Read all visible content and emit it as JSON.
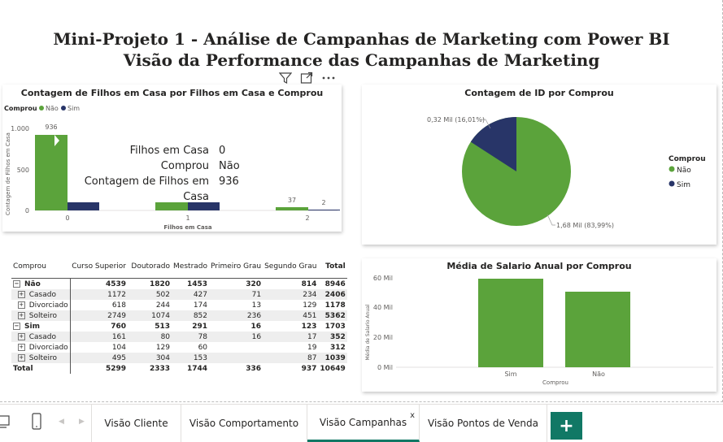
{
  "report": {
    "title_line1": "Mini-Projeto 1 - Análise de Campanhas de Marketing com Power BI",
    "title_line2": "Visão da Performance das Campanhas de Marketing"
  },
  "header_icons": [
    "filter-icon",
    "focus-mode-icon",
    "more-options-icon"
  ],
  "bar_visual": {
    "title": "Contagem de Filhos em Casa por Filhos em Casa e Comprou",
    "legend_title": "Comprou",
    "legend_nao": "Não",
    "legend_sim": "Sim",
    "y_axis_label": "Contagem de Filhos em Casa",
    "x_axis_label": "Filhos em Casa",
    "y_ticks": [
      "1.000",
      "500",
      "0"
    ],
    "label_936": "936",
    "label_37": "37",
    "label_2": "2",
    "x_ticks": [
      "0",
      "1",
      "2"
    ],
    "tooltip": {
      "k1": "Filhos em Casa",
      "v1": "0",
      "k2": "Comprou",
      "v2": "Não",
      "k3": "Contagem de Filhos em Casa",
      "v3": "936"
    }
  },
  "pie_visual": {
    "title": "Contagem de ID por Comprou",
    "label_sim": "0,32 Mil (16,01%)",
    "label_nao": "1,68 Mil (83,99%)",
    "legend_title": "Comprou",
    "legend_nao": "Não",
    "legend_sim": "Sim"
  },
  "salary_visual": {
    "title": "Média de Salario Anual por Comprou",
    "y_axis_label": "Média de Salario Anual",
    "x_axis_label": "Comprou",
    "y_ticks": [
      "60 Mil",
      "40 Mil",
      "20 Mil",
      "0 Mil"
    ],
    "x_ticks": [
      "Sim",
      "Não"
    ]
  },
  "matrix": {
    "headers": [
      "Comprou",
      "Curso Superior",
      "Doutorado",
      "Mestrado",
      "Primeiro Grau",
      "Segundo Grau",
      "Total"
    ],
    "rows": [
      {
        "label": "Não",
        "cells": [
          "4539",
          "1820",
          "1453",
          "320",
          "814",
          "8946"
        ]
      },
      {
        "label": "Casado",
        "cells": [
          "1172",
          "502",
          "427",
          "71",
          "234",
          "2406"
        ]
      },
      {
        "label": "Divorciado",
        "cells": [
          "618",
          "244",
          "174",
          "13",
          "129",
          "1178"
        ]
      },
      {
        "label": "Solteiro",
        "cells": [
          "2749",
          "1074",
          "852",
          "236",
          "451",
          "5362"
        ]
      },
      {
        "label": "Sim",
        "cells": [
          "760",
          "513",
          "291",
          "16",
          "123",
          "1703"
        ]
      },
      {
        "label": "Casado",
        "cells": [
          "161",
          "80",
          "78",
          "16",
          "17",
          "352"
        ]
      },
      {
        "label": "Divorciado",
        "cells": [
          "104",
          "129",
          "60",
          "",
          "19",
          "312"
        ]
      },
      {
        "label": "Solteiro",
        "cells": [
          "495",
          "304",
          "153",
          "",
          "87",
          "1039"
        ]
      },
      {
        "label": "Total",
        "cells": [
          "5299",
          "2333",
          "1744",
          "336",
          "937",
          "10649"
        ]
      }
    ]
  },
  "chart_data": [
    {
      "type": "bar",
      "title": "Contagem de Filhos em Casa por Filhos em Casa e Comprou",
      "xlabel": "Filhos em Casa",
      "ylabel": "Contagem de Filhos em Casa",
      "categories": [
        "0",
        "1",
        "2"
      ],
      "series": [
        {
          "name": "Não",
          "values": [
            936,
            80,
            37
          ]
        },
        {
          "name": "Sim",
          "values": [
            80,
            80,
            2
          ]
        }
      ],
      "ylim": [
        0,
        1000
      ]
    },
    {
      "type": "pie",
      "title": "Contagem de ID por Comprou",
      "categories": [
        "Não",
        "Sim"
      ],
      "values": [
        1680,
        320
      ],
      "percentages": [
        83.99,
        16.01
      ]
    },
    {
      "type": "bar",
      "title": "Média de Salario Anual por Comprou",
      "xlabel": "Comprou",
      "ylabel": "Média de Salario Anual",
      "categories": [
        "Sim",
        "Não"
      ],
      "values": [
        60000,
        51000
      ],
      "ylim": [
        0,
        60000
      ]
    }
  ],
  "colors": {
    "nao": "#5ba33b",
    "sim": "#283568",
    "accent": "#117865"
  },
  "tabs": [
    "Visão Cliente",
    "Visão Comportamento",
    "Visão Campanhas",
    "Visão Pontos de Venda"
  ],
  "tab_close": "x",
  "add_page": "+"
}
